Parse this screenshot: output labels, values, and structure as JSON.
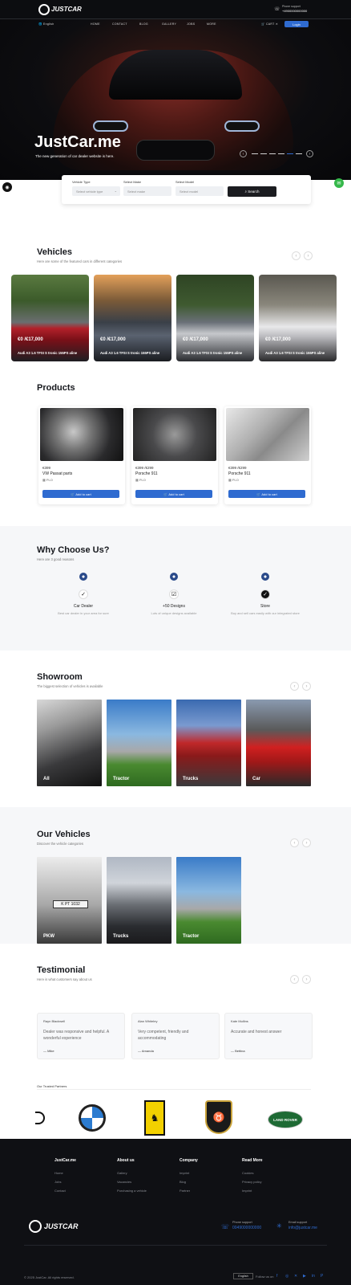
{
  "brand": {
    "name": "JUSTCAR"
  },
  "topbar": {
    "phone_label": "Phone support",
    "phone_number": "+4900000000000"
  },
  "nav": {
    "lang": "English",
    "links": [
      "HOME",
      "CONTACT",
      "BLOG",
      "GALLERY",
      "JOBS",
      "MORE"
    ],
    "cart": "CART",
    "login": "Login"
  },
  "hero": {
    "title": "JustCar.me",
    "subtitle": "The new generation of car dealer website is here."
  },
  "search": {
    "vehicle_type_label": "Vehicle Type",
    "vehicle_type_value": "Select vehicle type",
    "model_label": "Select Make",
    "model_placeholder": "Select make",
    "model2_label": "Select Model",
    "model2_placeholder": "Select model",
    "button": "Search"
  },
  "vehicles": {
    "title": "Vehicles",
    "subtitle": "Here are some of the featured cars in different categories",
    "cards": [
      {
        "price": "€0 /€17,000",
        "desc": "Audi A3 1.6 TFSI S tronic 155PS aline"
      },
      {
        "price": "€0 /€17,000",
        "desc": "Audi A3 1.6 TFSI S tronic 155PS aline"
      },
      {
        "price": "€0 /€17,000",
        "desc": "Audi A3 1.6 TFSI S tronic 155PS aline"
      },
      {
        "price": "€0 /€17,000",
        "desc": "Audi A3 1.6 TFSI S tronic 155PS aline"
      }
    ]
  },
  "products": {
    "title": "Products",
    "items": [
      {
        "price": "€399",
        "name": "VW Passat parts",
        "code": "PLO",
        "button": "Add to cart"
      },
      {
        "price": "€399 /€299",
        "name": "Porsche 911",
        "code": "PLO",
        "button": "Add to cart"
      },
      {
        "price": "€399 /€299",
        "name": "Porsche 911",
        "code": "PLO",
        "button": "Add to cart"
      }
    ]
  },
  "why": {
    "title": "Why Choose Us?",
    "subtitle": "Here are 3 good reasons",
    "items": [
      {
        "title": "Car Dealer",
        "text": "Best car dealer in your area for sure"
      },
      {
        "title": "+50 Designs",
        "text": "Lots of unique designs available"
      },
      {
        "title": "Store",
        "text": "Buy and sell cars easily with our integrated store"
      }
    ]
  },
  "showroom": {
    "title": "Showroom",
    "subtitle": "The biggest selection of vehicles is available",
    "tiles": [
      "All",
      "Tractor",
      "Trucks",
      "Car"
    ]
  },
  "our_vehicles": {
    "title": "Our Vehicles",
    "subtitle": "Discover the vehicle categories",
    "tiles": [
      "PKW",
      "Trucks",
      "Tractor"
    ]
  },
  "testimonial": {
    "title": "Testimonial",
    "subtitle": "Here is what customers say about us",
    "items": [
      {
        "name": "Rayn Blackwell",
        "text": "Dealer was responsive and helpful. A wonderful experience",
        "author": "Mike"
      },
      {
        "name": "Alan Whiteley",
        "text": "Very competent, friendly and accommodating",
        "author": "Amanda"
      },
      {
        "name": "Kate Mullins",
        "text": "Accurate and honest answer",
        "author": "Bettina"
      }
    ],
    "partners_label": "Our Trusted Partners"
  },
  "footer": {
    "columns": [
      {
        "title": "JustCar.me",
        "links": [
          "Home",
          "Jobs",
          "Contact"
        ]
      },
      {
        "title": "About us",
        "links": [
          "Gallery",
          "Vacancies",
          "Purchasing a vehicle"
        ]
      },
      {
        "title": "Company",
        "links": [
          "Imprint",
          "Blog",
          "Partner"
        ]
      },
      {
        "title": "Read More",
        "links": [
          "Cookies",
          "Privacy policy",
          "Imprint"
        ]
      }
    ],
    "phone_label": "Phone support",
    "phone_number": "0049000000000",
    "email_label": "Email support",
    "email": "info@justcar.me",
    "copyright": "© 2025 JustCar. All rights reserved.",
    "lang": "English",
    "follow": "Follow us on"
  },
  "colors": {
    "accent": "#2f6bd0",
    "dark": "#0c0d10",
    "green": "#35b84a"
  }
}
